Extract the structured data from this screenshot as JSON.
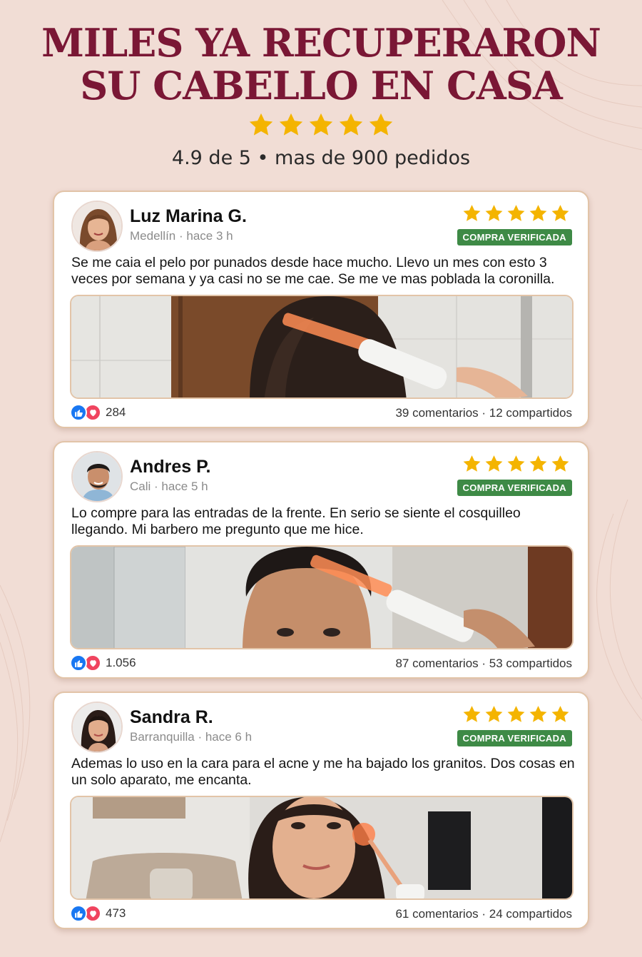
{
  "header": {
    "headline_line1": "MILES YA RECUPERARON",
    "headline_line2": "SU CABELLO EN CASA",
    "star_count": 5,
    "rating_text": "4.9 de 5 • mas de 900 pedidos"
  },
  "colors": {
    "headline": "#7a1735",
    "star": "#f4b400",
    "verified_badge": "#3e8a46",
    "like": "#1877f2",
    "love": "#f0445f"
  },
  "reviews": [
    {
      "name": "Luz Marina G.",
      "meta": "Medellín · hace 3 h",
      "stars": 5,
      "badge": "COMPRA VERIFICADA",
      "text": "Se me caia el pelo por punados desde hace mucho. Llevo un mes con esto 3 veces por semana y ya casi no se me cae. Se me ve mas poblada la coronilla.",
      "reactions": "284",
      "engagement": "39 comentarios · 12 compartidos",
      "photo_icon": "comb-electrode-on-scalp-photo"
    },
    {
      "name": "Andres P.",
      "meta": "Cali · hace 5 h",
      "stars": 5,
      "badge": "COMPRA VERIFICADA",
      "text": "Lo compre para las entradas de la frente. En serio se siente el cosquilleo llegando. Mi barbero me pregunto que me hice.",
      "reactions": "1.056",
      "engagement": "87 comentarios · 53 compartidos",
      "photo_icon": "comb-electrode-on-hairline-photo"
    },
    {
      "name": "Sandra R.",
      "meta": "Barranquilla · hace 6 h",
      "stars": 5,
      "badge": "COMPRA VERIFICADA",
      "text": "Ademas lo uso en la cara para el acne y me ha bajado los granitos. Dos cosas en un solo aparato, me encanta.",
      "reactions": "473",
      "engagement": "61 comentarios · 24 compartidos",
      "photo_icon": "mushroom-electrode-on-cheek-photo"
    }
  ]
}
